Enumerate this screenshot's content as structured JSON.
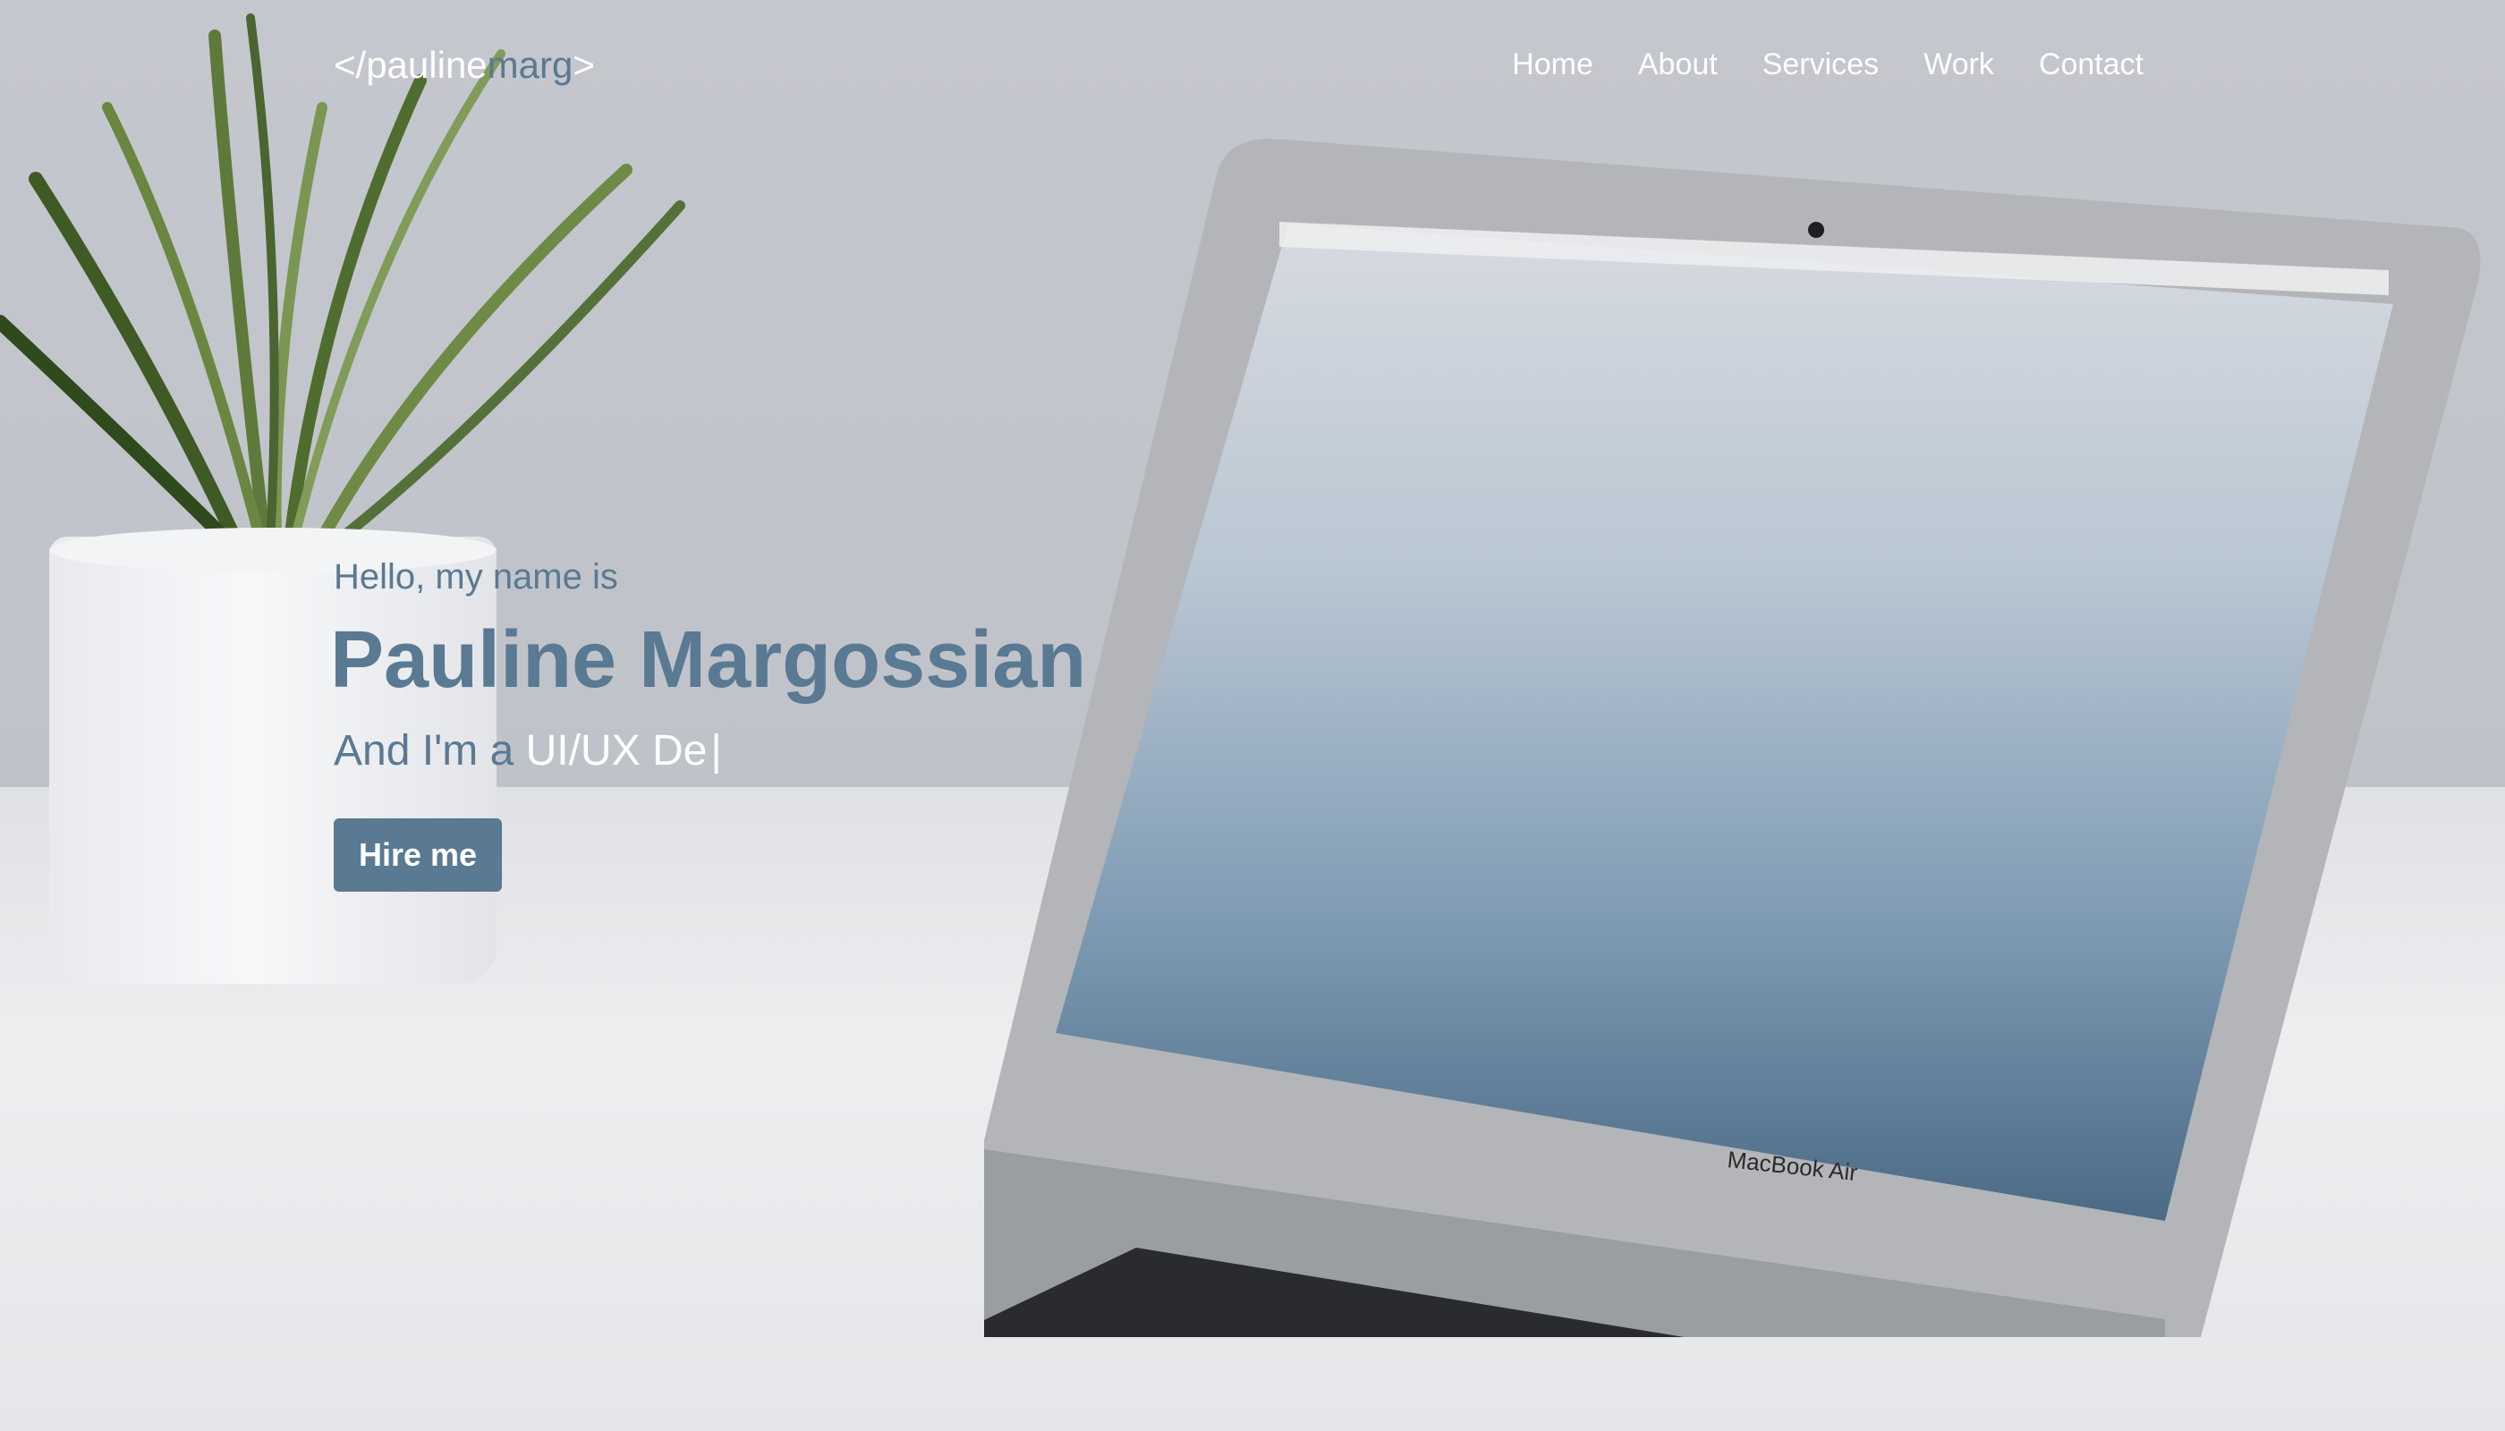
{
  "site": {
    "logo_prefix": "</",
    "logo_first": "pauline",
    "logo_second": "marg",
    "logo_suffix": ">"
  },
  "nav": {
    "items": [
      {
        "label": "Home"
      },
      {
        "label": "About"
      },
      {
        "label": "Services"
      },
      {
        "label": "Work"
      },
      {
        "label": "Contact"
      }
    ]
  },
  "hero": {
    "greeting": "Hello, my name is",
    "name": "Pauline Margossian",
    "role_prefix": "And I'm a ",
    "role_typed": "UI/UX De",
    "cursor": "|",
    "cta_label": "Hire me"
  },
  "background": {
    "laptop_label": "MacBook Air"
  },
  "colors": {
    "accent": "#5a7992",
    "nav_text": "#ffffff"
  }
}
